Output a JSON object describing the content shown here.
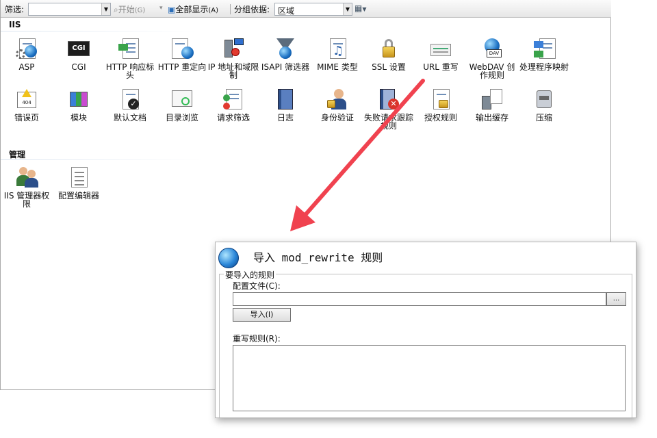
{
  "toolbar": {
    "filter_label": "筛选:",
    "filter_value": "",
    "go_label": "开始",
    "go_shortcut": "(G)",
    "show_all_label": "全部显示",
    "show_all_shortcut": "(A)",
    "group_by_label": "分组依据:",
    "group_by_value": "区域"
  },
  "sections": {
    "iis": "IIS",
    "manage": "管理"
  },
  "features": [
    {
      "label": "ASP",
      "icon": "asp-icon"
    },
    {
      "label": "CGI",
      "icon": "cgi-icon"
    },
    {
      "label": "HTTP 响应标头",
      "icon": "http-response-headers-icon"
    },
    {
      "label": "HTTP 重定向",
      "icon": "http-redirect-icon"
    },
    {
      "label": "IP 地址和域限制",
      "icon": "ip-restrictions-icon"
    },
    {
      "label": "ISAPI 筛选器",
      "icon": "isapi-filters-icon"
    },
    {
      "label": "MIME 类型",
      "icon": "mime-types-icon"
    },
    {
      "label": "SSL 设置",
      "icon": "ssl-lock-icon"
    },
    {
      "label": "URL 重写",
      "icon": "url-rewrite-icon"
    },
    {
      "label": "WebDAV 创作规则",
      "icon": "webdav-icon"
    },
    {
      "label": "处理程序映射",
      "icon": "handler-mappings-icon"
    },
    {
      "label": "错误页",
      "icon": "error-pages-icon"
    },
    {
      "label": "模块",
      "icon": "modules-icon"
    },
    {
      "label": "默认文档",
      "icon": "default-document-icon"
    },
    {
      "label": "目录浏览",
      "icon": "directory-browsing-icon"
    },
    {
      "label": "请求筛选",
      "icon": "request-filtering-icon"
    },
    {
      "label": "日志",
      "icon": "logging-icon"
    },
    {
      "label": "身份验证",
      "icon": "authentication-icon"
    },
    {
      "label": "失败请求跟踪规则",
      "icon": "failed-request-tracing-icon"
    },
    {
      "label": "授权规则",
      "icon": "authorization-rules-icon"
    },
    {
      "label": "输出缓存",
      "icon": "output-caching-icon"
    },
    {
      "label": "压缩",
      "icon": "compression-icon"
    }
  ],
  "manage_features": [
    {
      "label": "IIS 管理器权限",
      "icon": "iis-manager-permissions-icon"
    },
    {
      "label": "配置编辑器",
      "icon": "configuration-editor-icon"
    }
  ],
  "dialog": {
    "title": "导入 mod_rewrite 规则",
    "group_title": "要导入的规则",
    "config_file_label": "配置文件(C):",
    "config_file_value": "",
    "browse_label": "...",
    "import_label": "导入(I)",
    "rewrite_rules_label": "重写规则(R):",
    "rewrite_rules_value": ""
  },
  "colors": {
    "annotation_arrow": "#f0424f"
  }
}
